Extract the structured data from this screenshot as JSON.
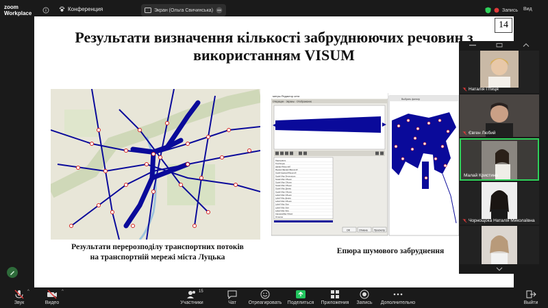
{
  "topbar": {
    "logo_line1": "zoom",
    "logo_line2": "Workplace",
    "conference_label": "Конференция",
    "screen_label": "Экран (Ольга Свичинська)",
    "record_label": "Запись",
    "view_label": "Вид"
  },
  "slide": {
    "number": "14",
    "title_line1": "Результати визначення кількості забруднюючих речовин з",
    "title_line2": "використанням VISUM",
    "caption_left_line1": "Результати перерозподілу транспортних потоків",
    "caption_left_line2": "на транспортній мережі міста Луцька",
    "caption_right": "Епюра шумового забруднення",
    "editor_title": "метры Редактор сети",
    "editor_menu": "Операции · Экраны · Отображение",
    "editor_ok": "OK",
    "editor_cancel": "Отмена",
    "editor_view": "Просмотр",
    "map2_toolbar": "Выбрать фильтр",
    "params": [
      "Нарисовать",
      "Тип/Опция",
      "Шрифт/Масштаб",
      "Формат/Шрифт/Масштаб",
      "Scale/ Шрифт/Масштаб",
      "Scale/ Max Dimensions",
      "Scale/ Max Объем",
      "Scale/ Max Объем",
      "Scale/ Max Объем",
      "Scale/ Max Длина",
      "Scale/ Max Объем",
      "Label/ Max Объем",
      "Label/ Max Длина",
      "Label/ Max Объем",
      "Label/ Max Size",
      "Label/ Max Size",
      "Label/ Max Size",
      "Standard/Bar Wheel",
      "Отметка"
    ]
  },
  "participants": [
    {
      "name": "Наталія Птиця",
      "muted": true
    },
    {
      "name": "Євген Любий",
      "muted": true
    },
    {
      "name": "Малай Кристина",
      "muted": false,
      "active": true
    },
    {
      "name": "Чорнощока Наталія Миколаївна",
      "muted": true
    },
    {
      "name": "",
      "muted": false
    }
  ],
  "toolbar": {
    "audio": "Звук",
    "video": "Видео",
    "participants": "Участники",
    "participants_count": "15",
    "chat": "Чат",
    "react": "Отреагировать",
    "share": "Поделиться",
    "apps": "Приложения",
    "record": "Запись",
    "more": "Дополнительно",
    "leave": "Выйти"
  },
  "colors": {
    "accent_green": "#2fd05a",
    "mute_red": "#e03a3a",
    "share_green": "#22c55e",
    "network_blue": "#0a0a9a",
    "route_red": "#d42020"
  }
}
